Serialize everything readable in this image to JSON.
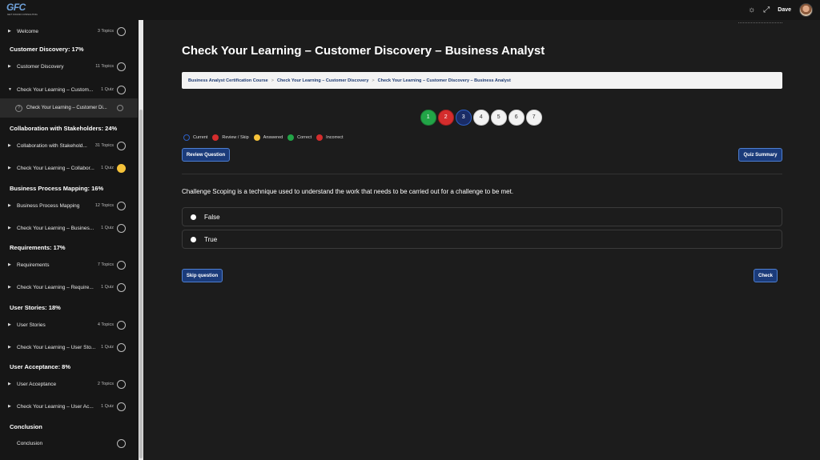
{
  "header": {
    "logo_text": "GFC",
    "logo_tagline": "GET FOUND CONSULTING",
    "theme_icon": "sun-icon",
    "fullscreen_icon": "expand-icon",
    "username": "Dave"
  },
  "sidebar": {
    "rows": [
      {
        "label": "Welcome",
        "count": "3 Topics"
      },
      {
        "label": "Customer Discovery",
        "count": "11 Topics"
      },
      {
        "label": "Check Your Learning – Custom...",
        "count": "1 Quiz"
      },
      {
        "label": "Check Your Learning – Customer Di...",
        "count": ""
      },
      {
        "label": "Collaboration with Stakehold...",
        "count": "31 Topics"
      },
      {
        "label": "Check Your Learning – Collabor...",
        "count": "1 Quiz"
      },
      {
        "label": "Business Process Mapping",
        "count": "12 Topics"
      },
      {
        "label": "Check Your Learning – Busines...",
        "count": "1 Quiz"
      },
      {
        "label": "Requirements",
        "count": "7 Topics"
      },
      {
        "label": "Check Your Learning – Require...",
        "count": "1 Quiz"
      },
      {
        "label": "User Stories",
        "count": "4 Topics"
      },
      {
        "label": "Check Your Learning – User Sto...",
        "count": "1 Quiz"
      },
      {
        "label": "User Acceptance",
        "count": "2 Topics"
      },
      {
        "label": "Check Your Learning – User Ac...",
        "count": "1 Quiz"
      },
      {
        "label": "Conclusion",
        "count": ""
      }
    ],
    "sections": [
      "Customer Discovery: 17%",
      "Collaboration with Stakeholders: 24%",
      "Business Process Mapping: 16%",
      "Requirements: 17%",
      "User Stories: 18%",
      "User Acceptance: 8%",
      "Conclusion"
    ]
  },
  "main": {
    "title": "Check Your Learning – Customer Discovery – Business Analyst",
    "breadcrumb": [
      "Business Analyst Certification Course",
      "Check Your Learning – Customer Discovery",
      "Check Your Learning – Customer Discovery – Business Analyst"
    ],
    "breadcrumb_sep": ">",
    "question_numbers": [
      {
        "n": "1",
        "state": "correct"
      },
      {
        "n": "2",
        "state": "incorrect"
      },
      {
        "n": "3",
        "state": "current"
      },
      {
        "n": "4",
        "state": "blank"
      },
      {
        "n": "5",
        "state": "blank"
      },
      {
        "n": "6",
        "state": "blank"
      },
      {
        "n": "7",
        "state": "blank"
      }
    ],
    "legend": {
      "current": "Current",
      "review": "Review / Skip",
      "answered": "Answered",
      "correct": "Correct",
      "incorrect": "Incorrect"
    },
    "review_button": "Review Question",
    "summary_button": "Quiz Summary",
    "question_text": "Challenge Scoping is a technique used to understand the work that needs to be carried out for a challenge to be met.",
    "answers": [
      "False",
      "True"
    ],
    "skip_button": "Skip question",
    "check_button": "Check"
  },
  "colors": {
    "accent_blue": "#1b3b7a",
    "correct": "#22a447",
    "incorrect": "#d42d2d",
    "answered": "#f5c23a"
  }
}
